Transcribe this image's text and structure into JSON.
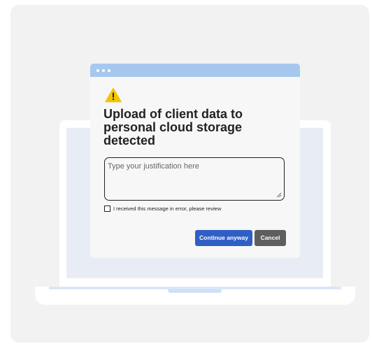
{
  "dialog": {
    "heading": "Upload of client data to personal cloud storage detected",
    "justification": {
      "placeholder": "Type your justification here",
      "value": ""
    },
    "checkbox": {
      "label": "I received this message in error, please review",
      "checked": false
    },
    "buttons": {
      "continue_label": "Continue anyway",
      "cancel_label": "Cancel"
    },
    "warning_icon": "warning-triangle-icon"
  },
  "colors": {
    "titlebar": "#a6c8ef",
    "primary_button": "#2f5fc4",
    "secondary_button": "#5e5e5e",
    "warning": "#f5c400",
    "screen": "#e8edf5",
    "background": "#f2f2f2"
  }
}
